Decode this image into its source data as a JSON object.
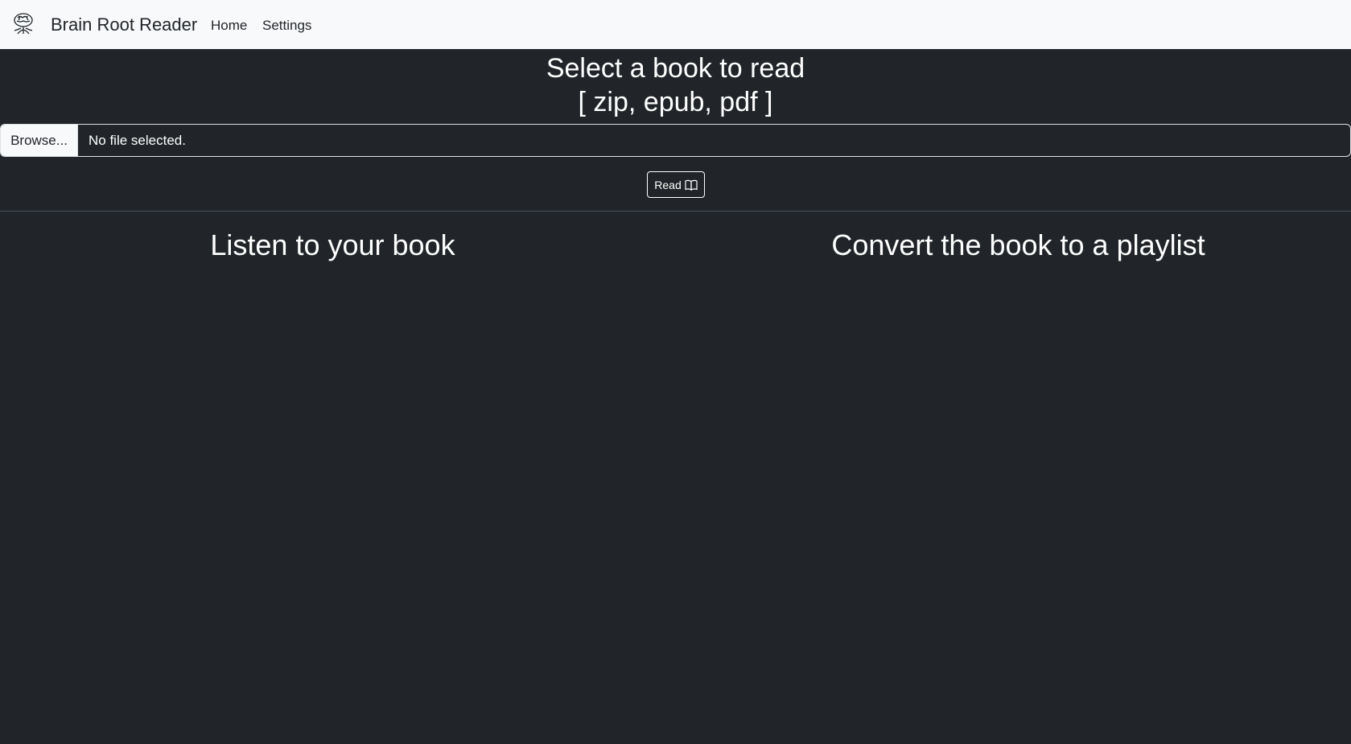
{
  "navbar": {
    "logo_icon": "brain-tree-logo-icon",
    "brand_name": "Brain Root Reader",
    "links": {
      "home": "Home",
      "settings": "Settings"
    },
    "background": "#f8f9fa"
  },
  "upload": {
    "title_line1": "Select a book to read",
    "title_line2": "[ zip, epub, pdf ]",
    "browse_label": "Browse...",
    "file_status": "No file selected.",
    "read_label": "Read",
    "read_icon": "book-open-icon"
  },
  "sections": {
    "listen_title": "Listen to your book",
    "playlist_title": "Convert the book to a playlist"
  },
  "theme": {
    "page_background": "#212529",
    "text_color": "#ffffff"
  }
}
